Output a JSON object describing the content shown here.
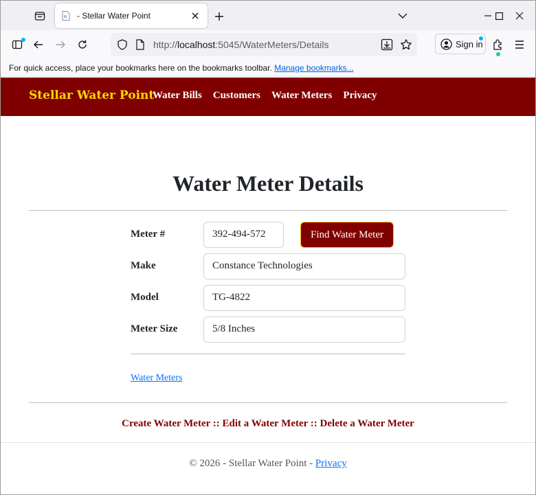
{
  "browser": {
    "tab_title": "- Stellar Water Point",
    "url_prefix": "http://",
    "url_host": "localhost",
    "url_rest": ":5045/WaterMeters/Details",
    "signin_label": "Sign in",
    "bookmarks_message": "For quick access, place your bookmarks here on the bookmarks toolbar.",
    "bookmarks_link": "Manage bookmarks..."
  },
  "header": {
    "brand": "Stellar Water Point",
    "nav": [
      "Water Bills",
      "Customers",
      "Water Meters",
      "Privacy"
    ]
  },
  "main": {
    "title": "Water Meter Details",
    "fields": {
      "meter_label": "Meter #",
      "meter_value": "392-494-572",
      "find_button": "Find Water Meter",
      "make_label": "Make",
      "make_value": "Constance Technologies",
      "model_label": "Model",
      "model_value": "TG-4822",
      "size_label": "Meter Size",
      "size_value": "5/8 Inches"
    },
    "back_link": "Water Meters",
    "actions": {
      "create": "Create Water Meter",
      "sep": "::",
      "edit": "Edit a Water Meter",
      "delete": "Delete a Water Meter"
    }
  },
  "footer": {
    "copyright": "© 2026 - Stellar Water Point -",
    "privacy": "Privacy"
  },
  "colors": {
    "header_bg": "#800000",
    "brand": "#ffd700",
    "button_border": "#ffc107",
    "link": "#0d6efd"
  }
}
